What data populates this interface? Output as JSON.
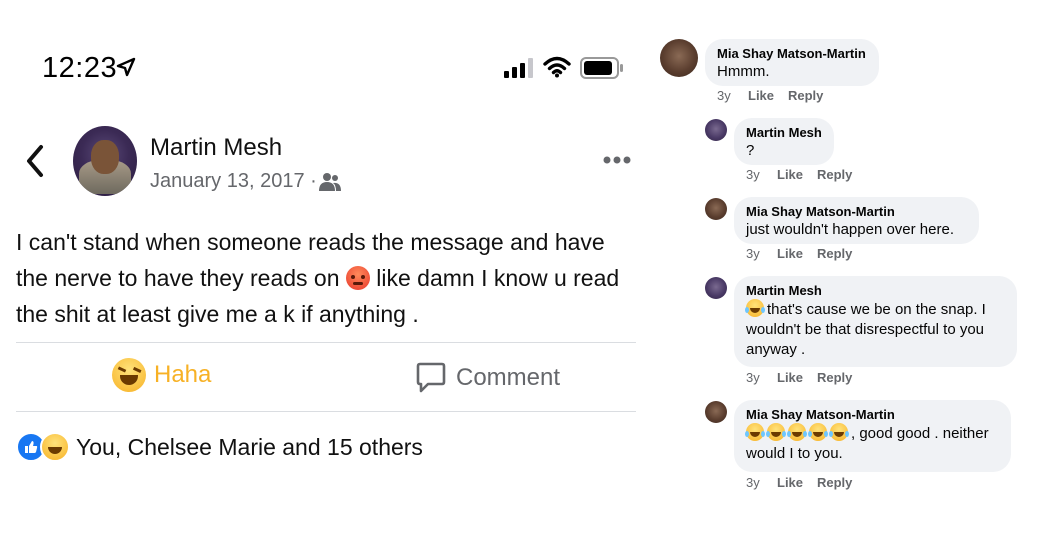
{
  "status_bar": {
    "time": "12:23"
  },
  "post": {
    "author": "Martin Mesh",
    "date": "January 13, 2017 ·",
    "text_part1": "I can't stand when someone reads the message and have the nerve to have they reads on",
    "text_part2": "like damn I know u read the shit at least give me a k if anything .",
    "inline_emoji": "angry-face-icon",
    "actions": {
      "haha_label": "Haha",
      "comment_label": "Comment"
    },
    "reactions_label": "You, Chelsee Marie and 15 others"
  },
  "colors": {
    "haha": "#f7b125",
    "like_blue": "#1877f2",
    "bubble": "#f0f2f5",
    "meta_gray": "#65676b"
  },
  "comments": [
    {
      "name": "Mia Shay Matson-Martin",
      "text": "Hmmm.",
      "time": "3y",
      "like": "Like",
      "reply": "Reply"
    },
    {
      "name": "Martin Mesh",
      "text": "?",
      "time": "3y",
      "like": "Like",
      "reply": "Reply"
    },
    {
      "name": "Mia Shay Matson-Martin",
      "text": "just wouldn't happen over here.",
      "time": "3y",
      "like": "Like",
      "reply": "Reply"
    },
    {
      "name": "Martin Mesh",
      "text": "that's cause we be on the snap. I wouldn't be that disrespectful to you anyway .",
      "time": "3y",
      "like": "Like",
      "reply": "Reply"
    },
    {
      "name": "Mia Shay Matson-Martin",
      "text": ", good good . neither would I to you.",
      "time": "3y",
      "like": "Like",
      "reply": "Reply"
    }
  ]
}
